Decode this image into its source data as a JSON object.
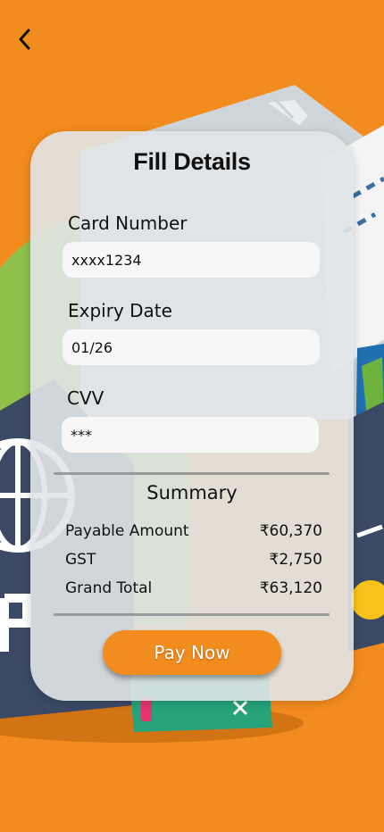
{
  "screen": {
    "background": "#f28c1e",
    "accent": "#f28c1e"
  },
  "header": {
    "back_icon": "chevron-left-icon"
  },
  "form": {
    "title": "Fill Details",
    "card_number": {
      "label": "Card Number",
      "value": "xxxx1234"
    },
    "expiry": {
      "label": "Expiry Date",
      "value": "01/26"
    },
    "cvv": {
      "label": "CVV",
      "value": "***"
    }
  },
  "summary": {
    "title": "Summary",
    "rows": [
      {
        "label": "Payable Amount",
        "value": "₹60,370"
      },
      {
        "label": "GST",
        "value": "₹2,750"
      },
      {
        "label": "Grand Total",
        "value": "₹63,120"
      }
    ]
  },
  "actions": {
    "pay_label": "Pay Now"
  }
}
